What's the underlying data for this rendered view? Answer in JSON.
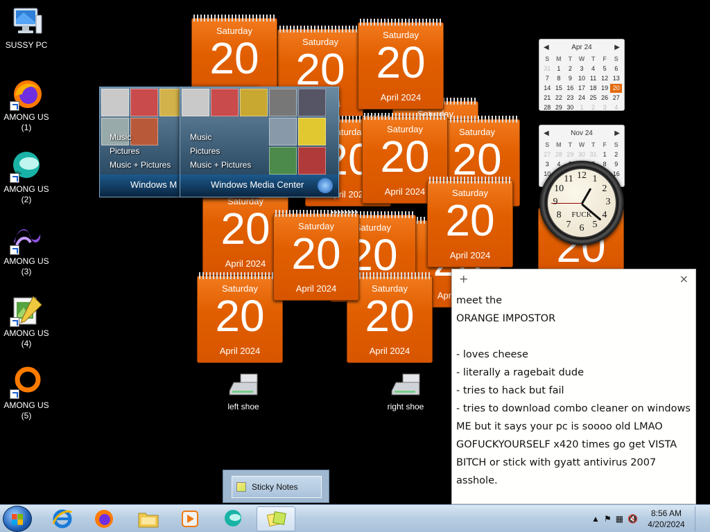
{
  "desktop_icons": [
    {
      "name": "sussy-pc-icon",
      "label": "SUSSY PC",
      "icon": "computer-monitor-icon"
    },
    {
      "name": "among-us-1-icon",
      "label": "AMONG US\n(1)",
      "icon": "firefox-icon"
    },
    {
      "name": "among-us-2-icon",
      "label": "AMONG US\n(2)",
      "icon": "teal-orb-icon"
    },
    {
      "name": "among-us-3-icon",
      "label": "AMONG US\n(3)",
      "icon": "visual-studio-icon"
    },
    {
      "name": "among-us-4-icon",
      "label": "AMONG US\n(4)",
      "icon": "notepad-pencil-icon"
    },
    {
      "name": "among-us-5-icon",
      "label": "AMONG US\n(5)",
      "icon": "orange-ring-icon"
    }
  ],
  "calendar_gadget": {
    "day_name": "Saturday",
    "day_number": "20",
    "month_year": "April 2024"
  },
  "month_calendars": [
    {
      "title": "Apr 24",
      "weekdays": [
        "S",
        "M",
        "T",
        "W",
        "T",
        "F",
        "S"
      ],
      "days": [
        "31",
        "1",
        "2",
        "3",
        "4",
        "5",
        "6",
        "7",
        "8",
        "9",
        "10",
        "11",
        "12",
        "13",
        "14",
        "15",
        "16",
        "17",
        "18",
        "19",
        "20",
        "21",
        "22",
        "23",
        "24",
        "25",
        "26",
        "27",
        "28",
        "29",
        "30",
        "1",
        "2",
        "3",
        "4"
      ]
    },
    {
      "title": "Nov 24",
      "weekdays": [
        "S",
        "M",
        "T",
        "W",
        "T",
        "F",
        "S"
      ],
      "days": [
        "27",
        "28",
        "29",
        "30",
        "31",
        "1",
        "2",
        "3",
        "4",
        "5",
        "6",
        "7",
        "8",
        "9",
        "10",
        "11",
        "12",
        "13",
        "14",
        "15",
        "16"
      ]
    }
  ],
  "clock": {
    "label": "FUCK",
    "numbers": [
      "12",
      "1",
      "2",
      "3",
      "4",
      "5",
      "6",
      "7",
      "8",
      "9",
      "10",
      "11"
    ]
  },
  "wmc": {
    "menu": [
      "Music",
      "Pictures",
      "Music + Pictures"
    ],
    "title_a": "Windows M",
    "title_b": "Windows Media Center"
  },
  "shoes": [
    {
      "label": "left shoe"
    },
    {
      "label": "right shoe"
    }
  ],
  "sticky_note": {
    "add_glyph": "+",
    "close_glyph": "×",
    "text": "meet the\nORANGE IMPOSTOR\n\n- loves cheese\n- literally a ragebait dude\n- tries to hack but fail\n- tries to download combo cleaner on windows ME but it says your pc is soooo old LMAO GOFUCKYOURSELF x420 times go get VISTA BITCH or stick with gyatt antivirus 2007 asshole."
  },
  "taskbar": {
    "sticky_tip_label": "Sticky Notes",
    "time": "8:56 AM",
    "date": "4/20/2024",
    "tray_icons": [
      "show-hidden-icons-arrow-icon",
      "action-center-flag-icon",
      "network-icon",
      "volume-muted-icon"
    ]
  },
  "colors": {
    "calendar_orange": "#e15f00",
    "desktop_bg": "#000000",
    "taskbar_bg": "#b7cde2"
  }
}
